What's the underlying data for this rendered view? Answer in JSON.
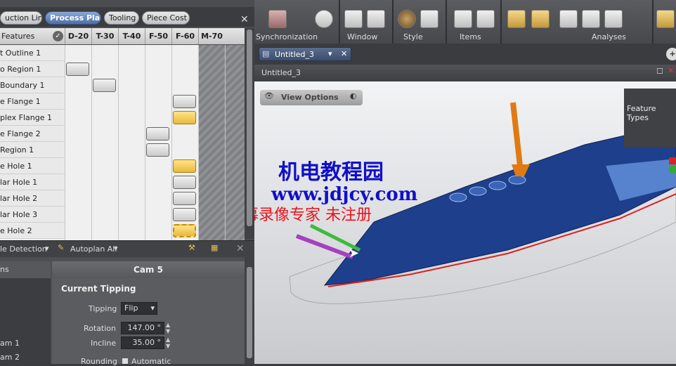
{
  "left": {
    "tabs": [
      "uction Line",
      "Process Plan",
      "Tooling",
      "Piece Cost"
    ],
    "active_tab": 1,
    "grid_header": {
      "features_label": "Features",
      "columns": [
        "D-20",
        "T-30",
        "T-40",
        "F-50",
        "F-60",
        "M-70"
      ]
    },
    "rows": [
      {
        "label": "t Outline 1",
        "col": -1
      },
      {
        "label": "o Region 1",
        "col": 0
      },
      {
        "label": "Boundary 1",
        "col": 1
      },
      {
        "label": "e Flange 1",
        "col": 4
      },
      {
        "label": "plex Flange 1",
        "col": 4,
        "style": "y"
      },
      {
        "label": "e Flange 2",
        "col": 3
      },
      {
        "label": " Region 1",
        "col": 3
      },
      {
        "label": "e Hole 1",
        "col": 4,
        "style": "y"
      },
      {
        "label": "lar Hole 1",
        "col": 4
      },
      {
        "label": "lar Hole 2",
        "col": 4
      },
      {
        "label": "lar Hole 3",
        "col": 4
      },
      {
        "label": "e Hole 2",
        "col": 4,
        "style": "y-dash"
      }
    ],
    "toolbar": {
      "detection_label": "le Detection",
      "autoplan_label": "Autoplan All"
    },
    "list_col": {
      "header": "ns",
      "items": [
        "am 1",
        "am 2"
      ]
    },
    "cam": {
      "title": "Cam 5",
      "section": "Current Tipping",
      "tipping_label": "Tipping",
      "tipping_value": "Flip",
      "rotation_label": "Rotation",
      "rotation_value": "147.00 °",
      "incline_label": "Incline",
      "incline_value": "35.00 °",
      "rounding_label": "Rounding",
      "rounding_value": "Automatic"
    }
  },
  "ribbon": {
    "groups": [
      "Synchronization",
      "Window",
      "Style",
      "Items",
      "Analyses"
    ]
  },
  "doc": {
    "tab_label": "Untitled_3",
    "title": "Untitled_3",
    "view_options": "View Options",
    "feature_types": "Feature Types"
  },
  "watermark": {
    "line1": "机电教程园",
    "line2": "www.jdjcy.com",
    "line3": "屏幕录像专家  未注册"
  },
  "colors": {
    "accent": "#4e6fa8",
    "part": "#1e3f8c",
    "tool_orange": "#e07a12",
    "watermark_red": "#e8161f",
    "watermark_blue": "#1010c8"
  }
}
